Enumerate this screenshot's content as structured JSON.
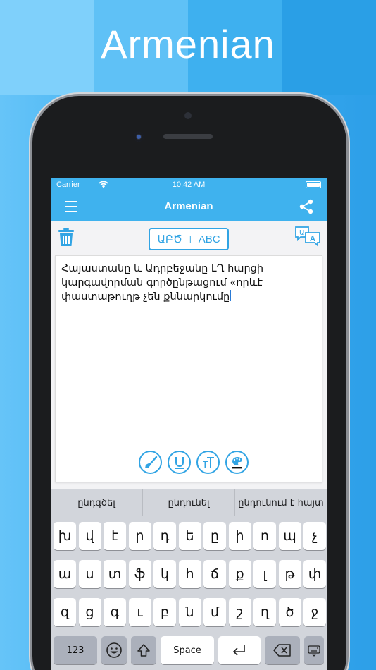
{
  "banner": {
    "title": "Armenian"
  },
  "status_bar": {
    "carrier": "Carrier",
    "time": "10:42 AM"
  },
  "nav": {
    "title": "Armenian",
    "menu_icon": "menu-icon",
    "share_icon": "share-icon"
  },
  "toolbar": {
    "trash_icon": "trash-icon",
    "script_armenian": "ԱԲԾ",
    "script_latin": "ABC",
    "translate_icon": "translate-icon"
  },
  "editor": {
    "text": "Հայաստանը և Ադրբեջանը ԼՂ հարցի կարգավորման գործընթացում «որևէ փաստաթուղթ չեն քննարկումը"
  },
  "format_tools": [
    "paintbrush-icon",
    "underline-icon",
    "text-size-icon",
    "color-palette-icon"
  ],
  "keyboard": {
    "suggestions": [
      "ընդգծել",
      "ընդունել",
      "ընդունում է հայտ"
    ],
    "row1": [
      "խ",
      "վ",
      "է",
      "ր",
      "դ",
      "ե",
      "ը",
      "ի",
      "ո",
      "պ",
      "չ"
    ],
    "row2": [
      "ա",
      "ս",
      "տ",
      "ֆ",
      "կ",
      "հ",
      "ճ",
      "ք",
      "լ",
      "թ",
      "փ"
    ],
    "row3": [
      "զ",
      "ց",
      "գ",
      "ւ",
      "բ",
      "ն",
      "մ",
      "շ",
      "ղ",
      "ծ",
      "ջ"
    ],
    "bottom": {
      "numbers": "123",
      "space": "Space"
    }
  },
  "colors": {
    "accent": "#31a4e4",
    "nav_bg": "#3fb2ee",
    "keyboard_bg": "#d2d5db"
  }
}
